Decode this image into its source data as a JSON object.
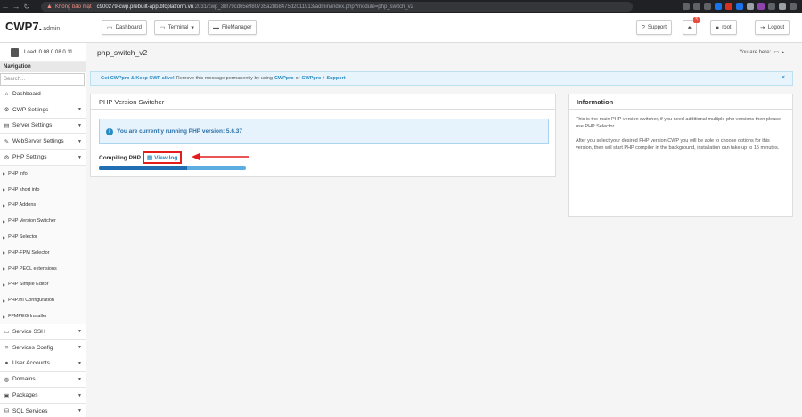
{
  "browser": {
    "not_secure": "Không bảo mật",
    "url_host": "c900279-cwp.prebuilt-app.bfcplatform.vn",
    "url_path": ":2031/cwp_3bf79cd65e980735a28b8475d2011913/admin/index.php?module=php_switch_v2"
  },
  "header": {
    "logo": "CWP7.",
    "logo_sub": "admin",
    "dashboard": "Dashboard",
    "terminal": "Terminal",
    "filemanager": "FileManager",
    "support": "Support",
    "notif_count": "3",
    "user": "root",
    "logout": "Logout"
  },
  "sidebar": {
    "load": "Load: 0.08  0.08  0.11",
    "nav_title": "Navigation",
    "search_placeholder": "Search...",
    "items": [
      {
        "label": "Dashboard",
        "icon": "home-icon",
        "glyph": "⌂",
        "caret": false
      },
      {
        "label": "CWP Settings",
        "icon": "gear-icon",
        "glyph": "⚙",
        "caret": true
      },
      {
        "label": "Server Settings",
        "icon": "server-icon",
        "glyph": "▤",
        "caret": true
      },
      {
        "label": "WebServer Settings",
        "icon": "wrench-icon",
        "glyph": "✎",
        "caret": true
      },
      {
        "label": "PHP Settings",
        "icon": "gear-icon",
        "glyph": "⚙",
        "caret": true
      }
    ],
    "sub_items": [
      "PHP info",
      "PHP short info",
      "PHP Addons",
      "PHP Version Switcher",
      "PHP Selector",
      "PHP-FPM Selector",
      "PHP PECL extensions",
      "PHP Simple Editor",
      "PHP.ini Configuration",
      "FFMPEG Installer"
    ],
    "items_after": [
      {
        "label": "Service SSH",
        "icon": "monitor-icon",
        "glyph": "▭",
        "caret": true
      },
      {
        "label": "Services Config",
        "icon": "list-icon",
        "glyph": "≡",
        "caret": true
      },
      {
        "label": "User Accounts",
        "icon": "user-icon",
        "glyph": "●",
        "caret": true
      },
      {
        "label": "Domains",
        "icon": "globe-icon",
        "glyph": "◍",
        "caret": true
      },
      {
        "label": "Packages",
        "icon": "package-icon",
        "glyph": "▣",
        "caret": true
      },
      {
        "label": "SQL Services",
        "icon": "database-icon",
        "glyph": "⛁",
        "caret": true
      }
    ]
  },
  "main": {
    "page_title": "php_switch_v2",
    "you_are_here": "You are here:",
    "alert": {
      "part1": "Get CWPpro & Keep CWP alive!",
      "part2": "Remove this message permanently by using",
      "link1": "CWPpro",
      "or": "or",
      "link2": "CWPpro + Support",
      "end": "."
    },
    "switcher_title": "PHP Version Switcher",
    "running_msg": "You are currently running PHP version: 5.6.37",
    "compiling_label": "Compiling PHP",
    "view_log": "View log",
    "progress": 0.6,
    "info_title": "Information",
    "info_p1": "This is the main PHP version switcher, if you need additional multiple php versions then please use PHP Selector.",
    "info_p2": "After you select your desired PHP version CWP you will be able to choose options for this version, then will start PHP compiler in the background, installation can take up to 15 minutes."
  }
}
